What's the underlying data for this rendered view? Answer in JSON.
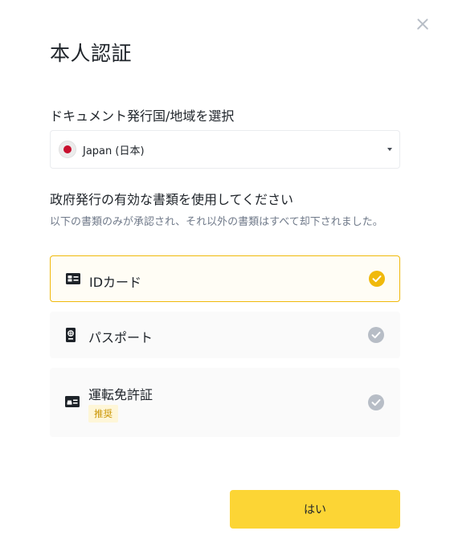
{
  "dialog": {
    "title": "本人認証",
    "close_icon": "close-icon"
  },
  "country": {
    "label": "ドキュメント発行国/地域を選択",
    "selected_value": "Japan (日本)",
    "flag_icon": "japan-flag-icon",
    "dropdown_icon": "caret-down-icon"
  },
  "documents": {
    "heading": "政府発行の有効な書類を使用してください",
    "note": "以下の書類のみが承認され、それ以外の書類はすべて却下されました。",
    "options": [
      {
        "label": "IDカード",
        "icon": "id-card-icon",
        "selected": true
      },
      {
        "label": "パスポート",
        "icon": "passport-icon",
        "selected": false
      },
      {
        "label": "運転免許証",
        "icon": "driver-license-icon",
        "selected": false,
        "badge": "推奨"
      }
    ]
  },
  "actions": {
    "confirm_label": "はい"
  },
  "colors": {
    "accent": "#fcd535",
    "selected_border": "#f0b90b",
    "check_selected": "#f0b90b",
    "check_unselected": "#b7bdc6",
    "badge_bg": "#fef6d8",
    "badge_text": "#c99400"
  }
}
